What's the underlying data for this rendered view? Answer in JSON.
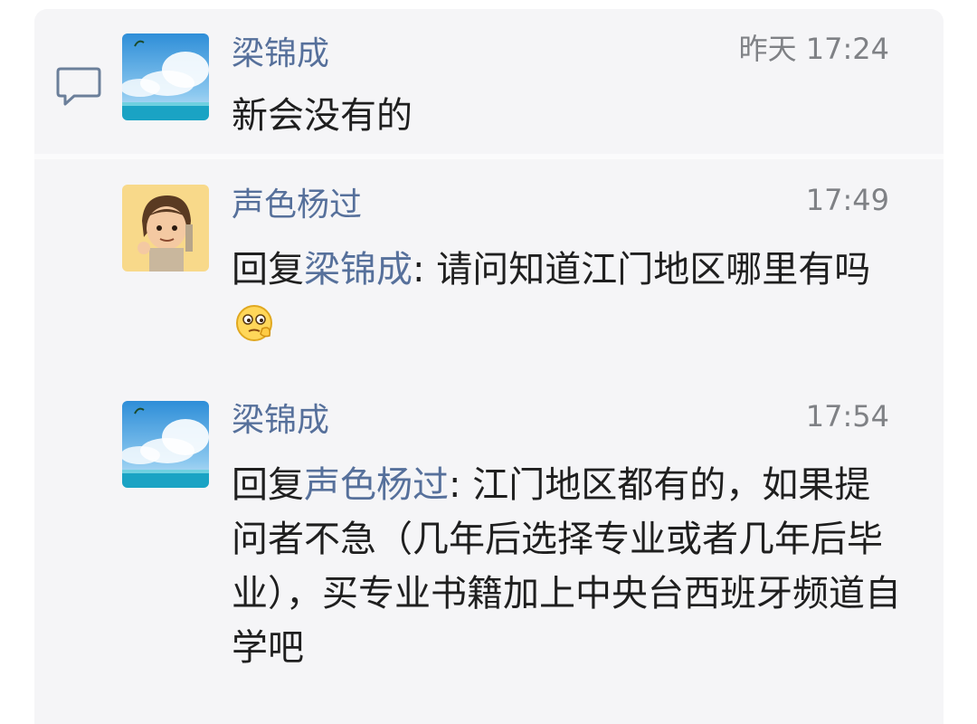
{
  "comments": [
    {
      "author": "梁锦成",
      "time": "昨天 17:24",
      "text": "新会没有的"
    },
    {
      "author": "声色杨过",
      "time": "17:49",
      "reply_prefix": "回复",
      "reply_to": "梁锦成",
      "reply_sep": ": ",
      "text": "请问知道江门地区哪里有吗"
    },
    {
      "author": "梁锦成",
      "time": "17:54",
      "reply_prefix": "回复",
      "reply_to": "声色杨过",
      "reply_sep": ": ",
      "text": "江门地区都有的，如果提问者不急（几年后选择专业或者几年后毕业），买专业书籍加上中央台西班牙频道自学吧"
    }
  ],
  "icons": {
    "comment": "speech-bubble-icon",
    "emoji": "thinking-face-emoji"
  },
  "colors": {
    "name": "#56709b",
    "time": "#7f8185",
    "text": "#1f1f1f",
    "panel": "#f5f5f7"
  }
}
